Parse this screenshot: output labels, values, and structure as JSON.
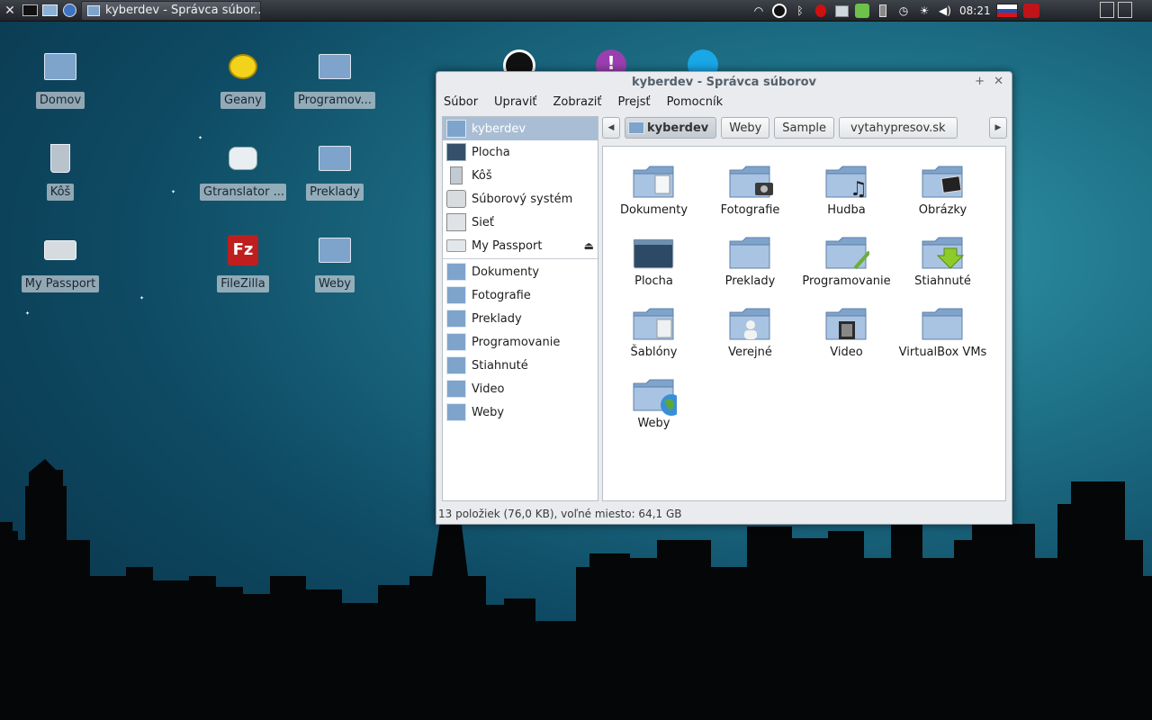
{
  "panel": {
    "task_title": "kyberdev - Správca súbor...",
    "clock": "08:21",
    "launchers": [
      "xfce-menu-icon",
      "terminal-icon",
      "file-manager-icon",
      "web-browser-icon"
    ]
  },
  "desktop": {
    "icons": [
      {
        "label": "Domov",
        "icon": "home-folder-icon"
      },
      {
        "label": "Geany",
        "icon": "geany-icon"
      },
      {
        "label": "Programov...",
        "icon": "folder-link-icon"
      },
      {
        "label": "Kôš",
        "icon": "trash-icon"
      },
      {
        "label": "Gtranslator ...",
        "icon": "gtranslator-icon"
      },
      {
        "label": "Preklady",
        "icon": "folder-link-icon"
      },
      {
        "label": "My Passport",
        "icon": "drive-icon"
      },
      {
        "label": "FileZilla",
        "icon": "filezilla-icon"
      },
      {
        "label": "Weby",
        "icon": "folder-link-icon"
      }
    ]
  },
  "window": {
    "title": "kyberdev - Správca súborov",
    "menu": [
      "Súbor",
      "Upraviť",
      "Zobraziť",
      "Prejsť",
      "Pomocník"
    ],
    "sidebar": {
      "devices": [
        {
          "label": "kyberdev",
          "icon": "home-icon",
          "selected": true
        },
        {
          "label": "Plocha",
          "icon": "desktop-icon"
        },
        {
          "label": "Kôš",
          "icon": "trash-icon"
        },
        {
          "label": "Súborový systém",
          "icon": "harddisk-icon"
        },
        {
          "label": "Sieť",
          "icon": "network-icon"
        },
        {
          "label": "My Passport",
          "icon": "drive-icon",
          "eject": true
        }
      ],
      "places": [
        {
          "label": "Dokumenty",
          "icon": "documents-folder-icon"
        },
        {
          "label": "Fotografie",
          "icon": "pictures-folder-icon"
        },
        {
          "label": "Preklady",
          "icon": "folder-icon"
        },
        {
          "label": "Programovanie",
          "icon": "programming-folder-icon"
        },
        {
          "label": "Stiahnuté",
          "icon": "downloads-folder-icon"
        },
        {
          "label": "Video",
          "icon": "video-folder-icon"
        },
        {
          "label": "Weby",
          "icon": "web-folder-icon"
        }
      ]
    },
    "pathbar": {
      "current": "kyberdev",
      "crumbs": [
        "Weby",
        "Sample",
        "vytahypresov.sk"
      ]
    },
    "files": [
      {
        "name": "Dokumenty",
        "badge": "document"
      },
      {
        "name": "Fotografie",
        "badge": "camera"
      },
      {
        "name": "Hudba",
        "badge": "music"
      },
      {
        "name": "Obrázky",
        "badge": "picture"
      },
      {
        "name": "Plocha",
        "badge": "desktop"
      },
      {
        "name": "Preklady",
        "badge": "none"
      },
      {
        "name": "Programovanie",
        "badge": "brush"
      },
      {
        "name": "Stiahnuté",
        "badge": "download"
      },
      {
        "name": "Šablóny",
        "badge": "template"
      },
      {
        "name": "Verejné",
        "badge": "person"
      },
      {
        "name": "Video",
        "badge": "film"
      },
      {
        "name": "VirtualBox VMs",
        "badge": "none"
      },
      {
        "name": "Weby",
        "badge": "globe"
      }
    ],
    "status": "13 položiek (76,0 KB), voľné miesto: 64,1 GB"
  },
  "colors": {
    "folder": "#7fa4cc",
    "folder_light": "#a9c4e2",
    "selection": "#a9bed4",
    "flag_white": "#ffffff",
    "flag_blue": "#1f4fb5",
    "flag_red": "#d7141a"
  }
}
